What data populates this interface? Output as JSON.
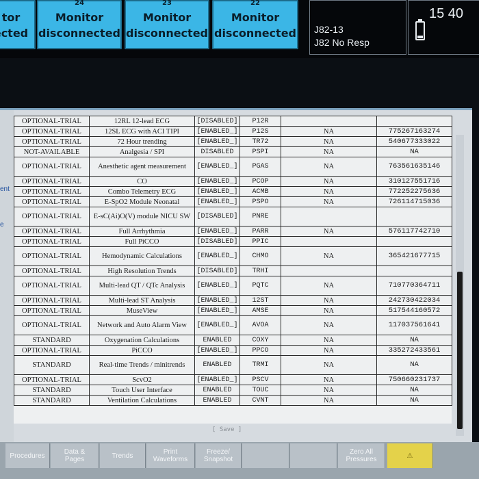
{
  "top": {
    "tiles": [
      {
        "num": "",
        "line1": "tor",
        "line2": "ected"
      },
      {
        "num": "24",
        "line1": "Monitor",
        "line2": "disconnected"
      },
      {
        "num": "23",
        "line1": "Monitor",
        "line2": "disconnected"
      },
      {
        "num": "22",
        "line1": "Monitor",
        "line2": "disconnected"
      }
    ],
    "status": {
      "line1": "J82-13",
      "line2": "J82 No Resp"
    },
    "clock": {
      "time": "15 40",
      "battery_icon": "battery-icon"
    }
  },
  "side": {
    "frag1": "ent",
    "frag2": "e"
  },
  "table": {
    "rows": [
      {
        "status": "OPTIONAL-TRIAL",
        "option": "12RL 12-lead ECG",
        "state": "[DISABLED]",
        "code": "P12R",
        "na": "",
        "license": ""
      },
      {
        "status": "OPTIONAL-TRIAL",
        "option": "12SL ECG with ACI TIPI",
        "state": "[ENABLED_]",
        "code": "P12S",
        "na": "NA",
        "license": "775267163274"
      },
      {
        "status": "OPTIONAL-TRIAL",
        "option": "72 Hour trending",
        "state": "[ENABLED_]",
        "code": "TR72",
        "na": "NA",
        "license": "540677333022"
      },
      {
        "status": "NOT-AVAILABLE",
        "option": "Analgesia / SPI",
        "state": "DISABLED",
        "code": "PSPI",
        "na": "NA",
        "license": "NA"
      },
      {
        "status": "OPTIONAL-TRIAL",
        "option": "Anesthetic agent measurement",
        "state": "[ENABLED_]",
        "code": "PGAS",
        "na": "NA",
        "license": "763561635146",
        "tall": true
      },
      {
        "status": "OPTIONAL-TRIAL",
        "option": "CO",
        "state": "[ENABLED_]",
        "code": "PCOP",
        "na": "NA",
        "license": "310127551716"
      },
      {
        "status": "OPTIONAL-TRIAL",
        "option": "Combo Telemetry ECG",
        "state": "[ENABLED_]",
        "code": "ACMB",
        "na": "NA",
        "license": "772252275636"
      },
      {
        "status": "OPTIONAL-TRIAL",
        "option": "E-SpO2 Module Neonatal",
        "state": "[ENABLED_]",
        "code": "PSPO",
        "na": "NA",
        "license": "726114715036"
      },
      {
        "status": "OPTIONAL-TRIAL",
        "option": "E-sC(Ai)O(V) module NICU SW",
        "state": "[DISABLED]",
        "code": "PNRE",
        "na": "",
        "license": "",
        "tall": true
      },
      {
        "status": "OPTIONAL-TRIAL",
        "option": "Full Arrhythmia",
        "state": "[ENABLED_]",
        "code": "PARR",
        "na": "NA",
        "license": "576117742710"
      },
      {
        "status": "OPTIONAL-TRIAL",
        "option": "Full PiCCO",
        "state": "[DISABLED]",
        "code": "PPIC",
        "na": "",
        "license": ""
      },
      {
        "status": "OPTIONAL-TRIAL",
        "option": "Hemodynamic Calculations",
        "state": "[ENABLED_]",
        "code": "CHMO",
        "na": "NA",
        "license": "365421677715",
        "tall": true
      },
      {
        "status": "OPTIONAL-TRIAL",
        "option": "High Resolution Trends",
        "state": "[DISABLED]",
        "code": "TRHI",
        "na": "",
        "license": ""
      },
      {
        "status": "OPTIONAL-TRIAL",
        "option": "Multi-lead QT / QTc Analysis",
        "state": "[ENABLED_]",
        "code": "PQTC",
        "na": "NA",
        "license": "710770364711",
        "tall": true
      },
      {
        "status": "OPTIONAL-TRIAL",
        "option": "Multi-lead ST Analysis",
        "state": "[ENABLED_]",
        "code": "12ST",
        "na": "NA",
        "license": "242730422034"
      },
      {
        "status": "OPTIONAL-TRIAL",
        "option": "MuseView",
        "state": "[ENABLED_]",
        "code": "AMSE",
        "na": "NA",
        "license": "517544160572"
      },
      {
        "status": "OPTIONAL-TRIAL",
        "option": "Network and Auto Alarm View",
        "state": "[ENABLED_]",
        "code": "AVOA",
        "na": "NA",
        "license": "117037561641",
        "tall": true
      },
      {
        "status": "STANDARD",
        "option": "Oxygenation Calculations",
        "state": "ENABLED",
        "code": "COXY",
        "na": "NA",
        "license": "NA"
      },
      {
        "status": "OPTIONAL-TRIAL",
        "option": "PiCCO",
        "state": "[ENABLED_]",
        "code": "PPCO",
        "na": "NA",
        "license": "335272433561"
      },
      {
        "status": "STANDARD",
        "option": "Real-time Trends / minitrends",
        "state": "ENABLED",
        "code": "TRMI",
        "na": "NA",
        "license": "NA",
        "tall": true
      },
      {
        "status": "OPTIONAL-TRIAL",
        "option": "ScvO2",
        "state": "[ENABLED_]",
        "code": "PSCV",
        "na": "NA",
        "license": "750660231737"
      },
      {
        "status": "STANDARD",
        "option": "Touch User Interface",
        "state": "ENABLED",
        "code": "TOUC",
        "na": "NA",
        "license": "NA"
      },
      {
        "status": "STANDARD",
        "option": "Ventilation Calculations",
        "state": "ENABLED",
        "code": "CVNT",
        "na": "NA",
        "license": "NA"
      }
    ],
    "save_label": "[ Save ]"
  },
  "softkeys": [
    {
      "label1": "Procedures",
      "label2": ""
    },
    {
      "label1": "Data &",
      "label2": "Pages"
    },
    {
      "label1": "Trends",
      "label2": ""
    },
    {
      "label1": "Print",
      "label2": "Waveforms"
    },
    {
      "label1": "Freeze/",
      "label2": "Snapshot"
    },
    {
      "label1": "",
      "label2": ""
    },
    {
      "label1": "",
      "label2": ""
    },
    {
      "label1": "Zero All",
      "label2": "Pressures"
    }
  ],
  "colors": {
    "tile": "#3bb6e6",
    "softkey_yellow": "#e4d24a",
    "screen_bg": "#d6dbe0"
  }
}
